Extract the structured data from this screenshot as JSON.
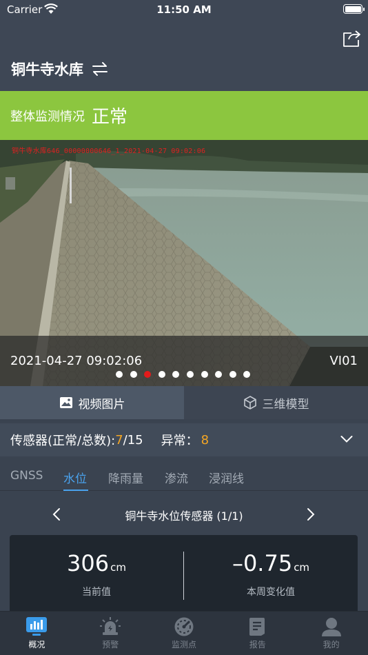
{
  "status_bar": {
    "carrier": "Carrier",
    "time": "11:50 AM"
  },
  "header": {
    "title": "铜牛寺水库"
  },
  "banner": {
    "label": "整体监测情况",
    "value": "正常",
    "color": "#8cc63f"
  },
  "camera": {
    "overlay_text": "铜牛寺水库646_00000000646_1_2021-04-27 09:02:06",
    "timestamp": "2021-04-27 09:02:06",
    "id": "VI01",
    "dot_count": 10,
    "active_dot_index": 2
  },
  "media_tabs": [
    {
      "label": "视频图片",
      "icon": "image-icon",
      "active": true
    },
    {
      "label": "三维模型",
      "icon": "cube-icon",
      "active": false
    }
  ],
  "sensor_summary": {
    "prefix": "传感器(正常/总数): ",
    "normal": "7",
    "total": "/15",
    "abnormal_label": "异常：",
    "abnormal": "8"
  },
  "sensor_tabs": [
    {
      "label": "GNSS",
      "active": false
    },
    {
      "label": "水位",
      "active": true
    },
    {
      "label": "降雨量",
      "active": false
    },
    {
      "label": "渗流",
      "active": false
    },
    {
      "label": "浸润线",
      "active": false
    }
  ],
  "sensor_nav": {
    "name": "铜牛寺水位传感器 (1/1)"
  },
  "readings": {
    "current": {
      "value": "306",
      "unit": "cm",
      "label": "当前值"
    },
    "weekly": {
      "value": "–0.75",
      "unit": "cm",
      "label": "本周变化值"
    }
  },
  "tab_bar": [
    {
      "label": "概况",
      "icon": "chart-icon",
      "active": true
    },
    {
      "label": "预警",
      "icon": "alarm-icon",
      "active": false
    },
    {
      "label": "监测点",
      "icon": "gauge-icon",
      "active": false
    },
    {
      "label": "报告",
      "icon": "report-icon",
      "active": false
    },
    {
      "label": "我的",
      "icon": "user-icon",
      "active": false
    }
  ],
  "colors": {
    "accent": "#4aa3ee",
    "warning": "#f5a623",
    "alert_dot": "#e31b1b"
  }
}
